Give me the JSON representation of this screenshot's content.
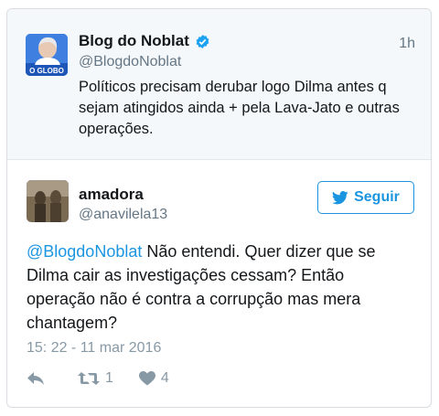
{
  "quoted_tweet": {
    "display_name": "Blog do Noblat",
    "handle": "@BlogdoNoblat",
    "time": "1h",
    "text": "Políticos precisam derubar logo Dilma antes q sejam atingidos ainda + pela Lava-Jato e outras operações.",
    "avatar_label": "O GLOBO",
    "verified": true
  },
  "reply_tweet": {
    "display_name": "amadora",
    "handle": "@anavilela13",
    "follow_label": "Seguir",
    "mention": "@BlogdoNoblat",
    "text": " Não entendi. Quer dizer que se Dilma cair as investigações cessam? Então operação não é contra a corrupção mas mera chantagem?",
    "timestamp": "15: 22 - 11 mar 2016",
    "retweet_count": "1",
    "like_count": "4"
  },
  "colors": {
    "accent": "#1b95e0",
    "secondary_text": "#657786",
    "action_icon": "#8899a6",
    "quoted_background": "#f5f8fa"
  },
  "icons": {
    "verified": "verified-badge-icon",
    "follow": "twitter-bird-icon",
    "reply": "reply-icon",
    "retweet": "retweet-icon",
    "like": "heart-icon"
  }
}
